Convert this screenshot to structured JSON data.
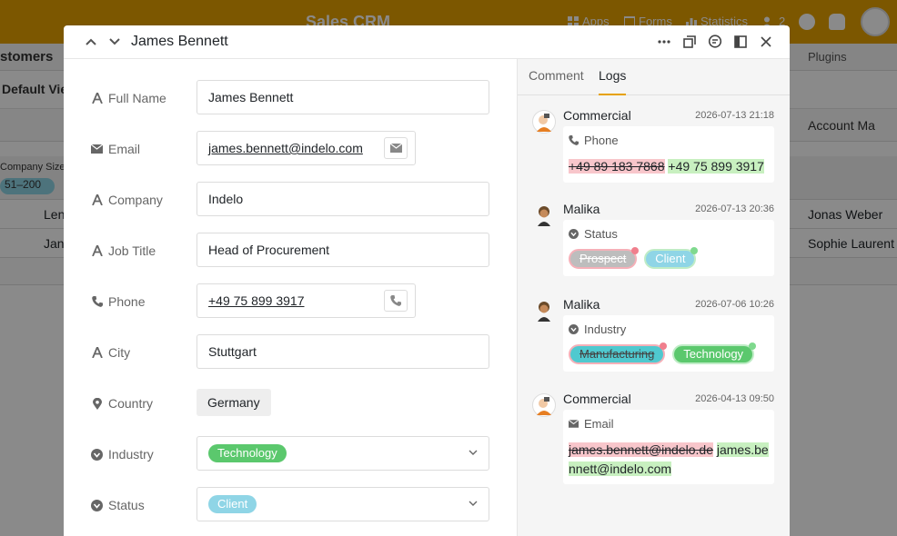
{
  "background": {
    "app_title": "Sales CRM",
    "nav": {
      "apps": "Apps",
      "forms": "Forms",
      "statistics": "Statistics",
      "users_count": "2"
    },
    "table_name": "stomers",
    "plugins": "Plugins",
    "view_name": "Default Vie",
    "col_account": "Account Ma",
    "group_label": "Company Size",
    "group_value": "51–200",
    "rows": [
      {
        "name": "Len",
        "manager": "Jonas Weber"
      },
      {
        "name": "Jan",
        "manager": "Sophie Laurent"
      }
    ],
    "colors": {
      "brand": "#e6a100"
    }
  },
  "modal": {
    "title": "James Bennett",
    "fields": [
      {
        "label": "Full Name",
        "icon": "text-icon",
        "value": "James Bennett"
      },
      {
        "label": "Email",
        "icon": "mail-icon",
        "value": "james.bennett@indelo.com"
      },
      {
        "label": "Company",
        "icon": "text-icon",
        "value": "Indelo"
      },
      {
        "label": "Job Title",
        "icon": "text-icon",
        "value": "Head of Procurement"
      },
      {
        "label": "Phone",
        "icon": "phone-icon",
        "value": "+49 75 899 3917"
      },
      {
        "label": "City",
        "icon": "text-icon",
        "value": "Stuttgart"
      },
      {
        "label": "Country",
        "icon": "location-icon",
        "value": "Germany"
      },
      {
        "label": "Industry",
        "icon": "single-select-icon",
        "value": "Technology"
      },
      {
        "label": "Status",
        "icon": "single-select-icon",
        "value": "Client"
      }
    ]
  },
  "side": {
    "tabs": [
      "Comment",
      "Logs"
    ],
    "active_tab": "Logs",
    "logs": [
      {
        "user": "Commercial",
        "time": "2026-07-13 21:18",
        "field": "Phone",
        "old": "+49 89 183 7868",
        "new": "+49 75 899 3917"
      },
      {
        "user": "Malika",
        "time": "2026-07-13 20:36",
        "field": "Status",
        "old": "Prospect",
        "new": "Client"
      },
      {
        "user": "Malika",
        "time": "2026-07-06 10:26",
        "field": "Industry",
        "old": "Manufacturing",
        "new": "Technology"
      },
      {
        "user": "Commercial",
        "time": "2026-04-13 09:50",
        "field": "Email",
        "old": "james.bennett@indelo.de",
        "new": "james.bennett@indelo.com"
      }
    ]
  }
}
